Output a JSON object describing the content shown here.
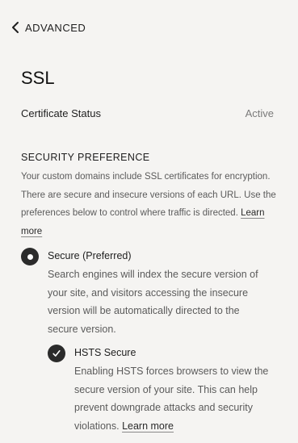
{
  "header": {
    "back_label": "ADVANCED"
  },
  "page": {
    "title": "SSL"
  },
  "certificate": {
    "label": "Certificate Status",
    "value": "Active"
  },
  "security_preference": {
    "heading": "SECURITY PREFERENCE",
    "description": "Your custom domains include SSL certificates for encryption. There are secure and insecure versions of each URL. Use the preferences below to control where traffic is directed.",
    "learn_more": "Learn more",
    "options": [
      {
        "title": "Secure (Preferred)",
        "description": "Search engines will index the secure version of your site, and visitors accessing the insecure version will be automatically directed to the secure version.",
        "selected": true
      }
    ],
    "hsts": {
      "title": "HSTS Secure",
      "description": "Enabling HSTS forces browsers to view the secure version of your site. This can help prevent downgrade attacks and security violations.",
      "learn_more": "Learn more",
      "checked": true
    }
  },
  "icons": {
    "back": "chevron-left-icon",
    "radio": "radio-selected-icon",
    "check": "checkmark-icon"
  }
}
